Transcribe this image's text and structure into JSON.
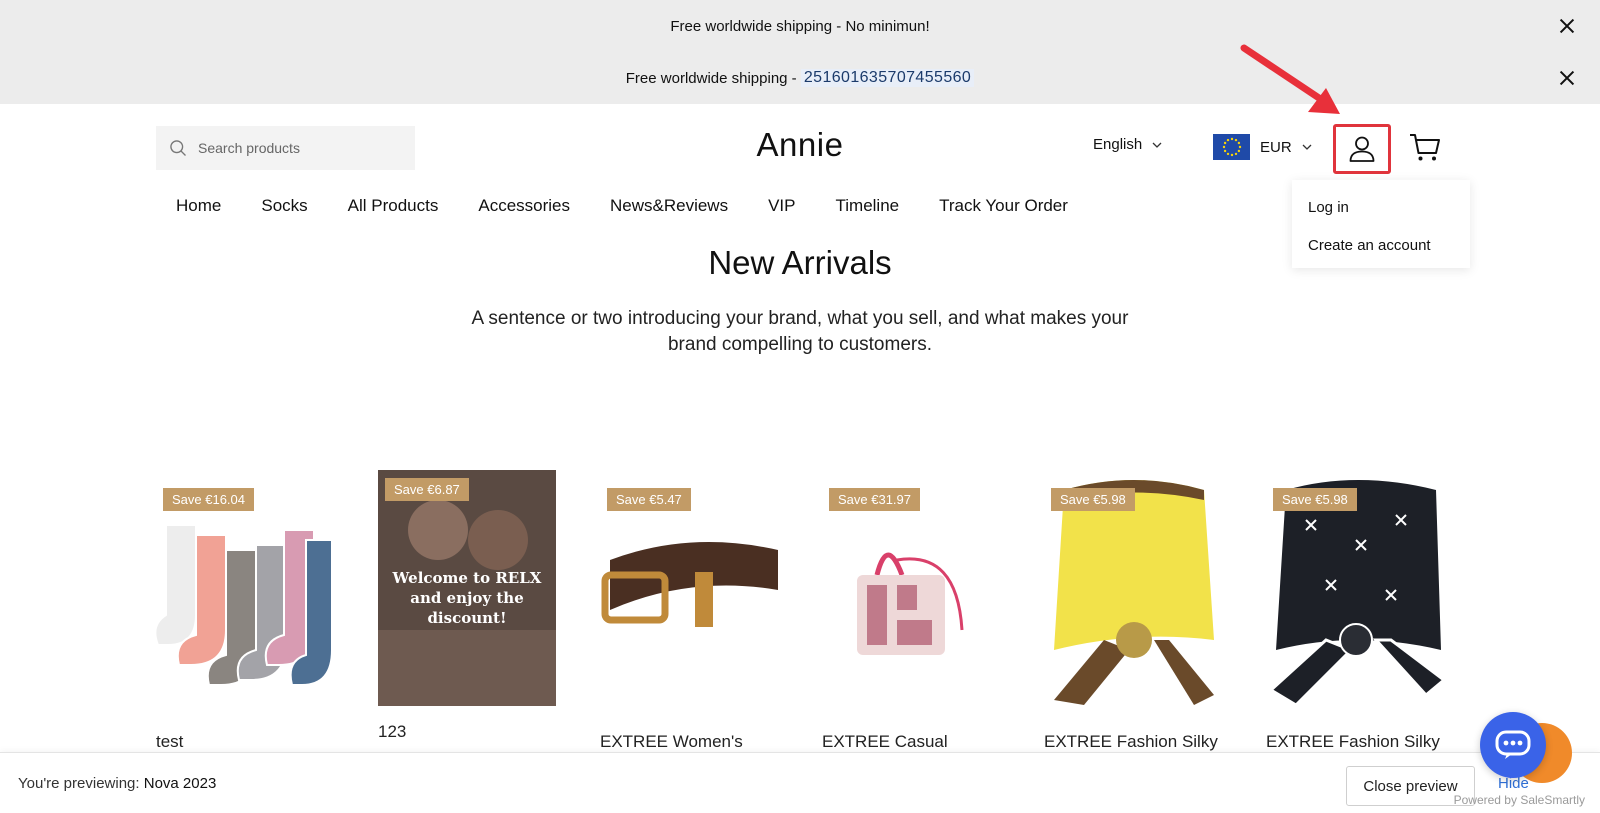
{
  "announcements": [
    {
      "text": "Free worldwide shipping - No minimun!"
    },
    {
      "prefix": "Free worldwide shipping - ",
      "number": "251601635707455560"
    }
  ],
  "header": {
    "search_placeholder": "Search products",
    "logo": "Annie",
    "language": "English",
    "currency": "EUR"
  },
  "account_menu": {
    "items": [
      "Log in",
      "Create an account"
    ]
  },
  "nav": [
    "Home",
    "Socks",
    "All Products",
    "Accessories",
    "News&Reviews",
    "VIP",
    "Timeline",
    "Track Your Order"
  ],
  "hero": {
    "title": "New Arrivals",
    "subtitle": "A sentence or two introducing your brand, what you sell, and what makes your brand compelling to customers."
  },
  "products": [
    {
      "badge": "Save €16.04",
      "name": "test"
    },
    {
      "badge": "Save €6.87",
      "name": "123",
      "image_text": "Welcome to RELX and enjoy the discount!"
    },
    {
      "badge": "Save €5.47",
      "name": "EXTREE Women's"
    },
    {
      "badge": "Save €31.97",
      "name": "EXTREE Casual"
    },
    {
      "badge": "Save €5.98",
      "name": "EXTREE Fashion Silky"
    },
    {
      "badge": "Save €5.98",
      "name": "EXTREE Fashion Silky"
    }
  ],
  "preview_bar": {
    "label": "You're previewing:",
    "theme": "Nova 2023",
    "close_button": "Close preview",
    "hide": "Hide",
    "powered": "Powered by SaleSmartly"
  },
  "colors": {
    "badge": "#c29b66",
    "highlight_border": "#e0343c",
    "chat_blue": "#3a63e8",
    "chat_orange": "#f08a2a",
    "announcement_bg": "#ececec"
  }
}
